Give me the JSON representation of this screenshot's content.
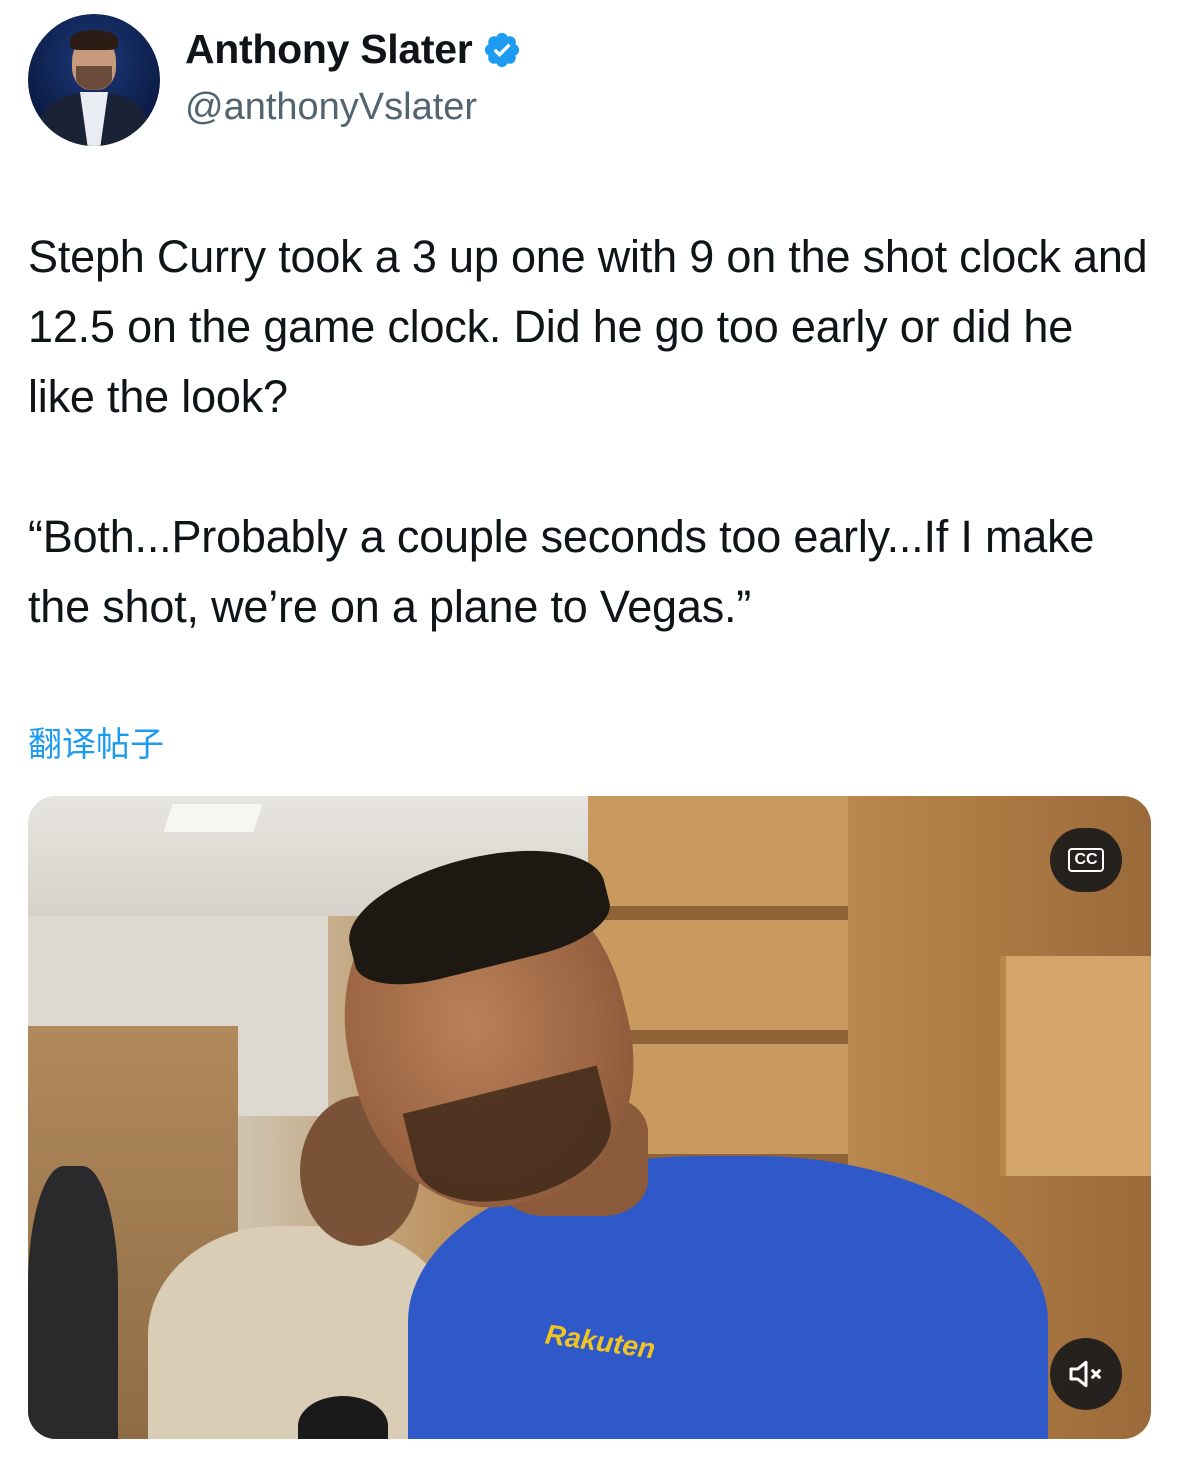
{
  "author": {
    "name": "Anthony Slater",
    "handle": "@anthonyVslater",
    "verified_color": "#1d9bf0"
  },
  "tweet": {
    "paragraph_1": "Steph Curry took a 3 up one with 9 on the shot clock and 12.5 on the game clock. Did he go too early or did he like the look?",
    "paragraph_2": "“Both...Probably a couple seconds too early...If I make the shot, we’re on a plane to Vegas.”",
    "translate_label": "翻译帖子"
  },
  "media": {
    "cc_label": "CC",
    "jersey_text": "Rakuten",
    "icons": [
      "closed-captions-icon",
      "muted-speaker-icon"
    ]
  }
}
